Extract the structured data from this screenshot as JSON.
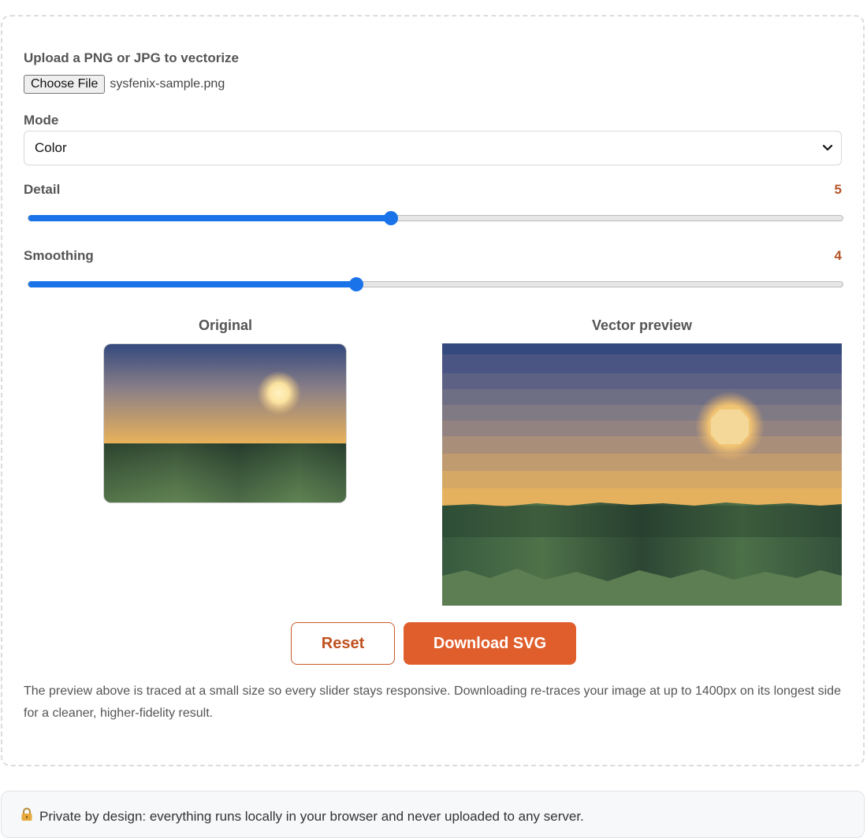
{
  "upload": {
    "label": "Upload a PNG or JPG to vectorize",
    "button_label": "Choose File",
    "file_name": "sysfenix-sample.png"
  },
  "mode": {
    "label": "Mode",
    "selected": "Color"
  },
  "detail": {
    "label": "Detail",
    "value": "5",
    "fraction": 0.445
  },
  "smoothing": {
    "label": "Smoothing",
    "value": "4",
    "fraction": 0.403
  },
  "previews": {
    "original_title": "Original",
    "vector_title": "Vector preview"
  },
  "buttons": {
    "reset": "Reset",
    "download": "Download SVG"
  },
  "note": "The preview above is traced at a small size so every slider stays responsive. Downloading re-traces your image at up to 1400px on its longest side for a cleaner, higher-fidelity result.",
  "privacy": {
    "icon": "lock-icon",
    "text": "Private by design: everything runs locally in your browser and never uploaded to any server."
  },
  "colors": {
    "accent": "#e05e2c",
    "slider": "#1a73e8",
    "value_text": "#b5542a"
  }
}
